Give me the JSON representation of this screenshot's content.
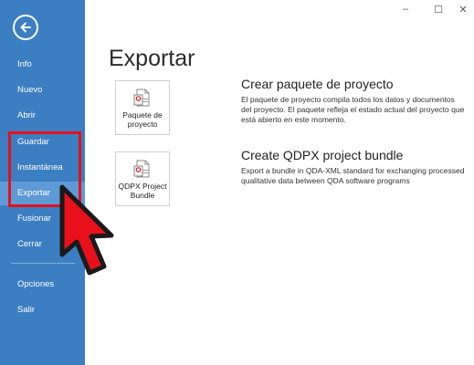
{
  "sidebar": {
    "items": [
      {
        "label": "Info"
      },
      {
        "label": "Nuevo"
      },
      {
        "label": "Abrir"
      },
      {
        "label": "Guardar"
      },
      {
        "label": "Instantánea"
      },
      {
        "label": "Exportar"
      },
      {
        "label": "Fusionar"
      },
      {
        "label": "Cerrar"
      },
      {
        "label": "Opciones"
      },
      {
        "label": "Salir"
      }
    ],
    "active": "Exportar"
  },
  "window_controls": {
    "minimize": "–",
    "maximize": "☐",
    "close": "✕"
  },
  "main": {
    "title": "Exportar",
    "options": [
      {
        "tile_label": "Paquete de proyecto",
        "heading": "Crear paquete de proyecto",
        "description": "El paquete de proyecto compila todos los datos y documentos del proyecto. El paquete refleja el estado actual del proyecto que está abierto en este momento."
      },
      {
        "tile_label": "QDPX Project Bundle",
        "heading": "Create QDPX project bundle",
        "description": "Export a bundle in QDA-XML standard for exchanging processed qualitative data between QDA software programs"
      }
    ]
  },
  "colors": {
    "sidebar": "#3c7ec2",
    "sidebar_active": "#5e9ad6",
    "highlight": "#e8101a",
    "cursor": "#e8101a"
  },
  "icons": [
    "back-arrow-icon",
    "package-document-icon",
    "qdpx-document-icon",
    "red-cursor-arrow-icon"
  ]
}
